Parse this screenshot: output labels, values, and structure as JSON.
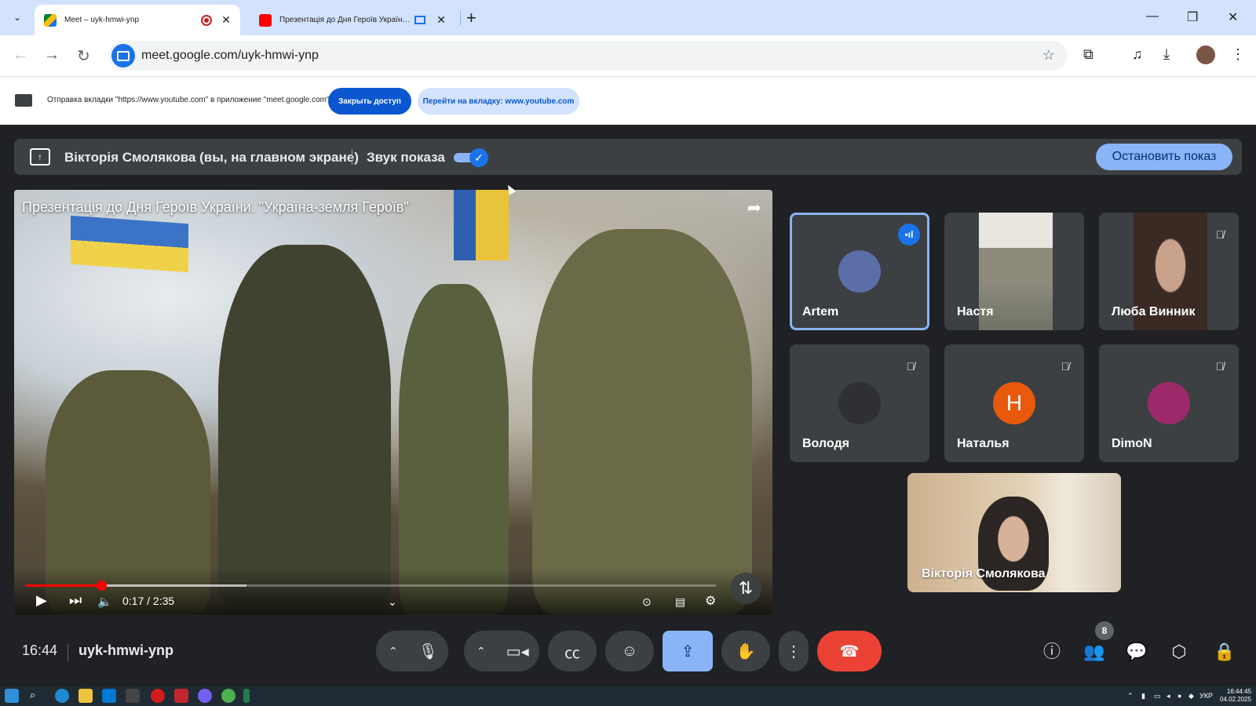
{
  "browser": {
    "tabs": [
      {
        "title": "Meet – uyk-hmwi-ynp",
        "favicon": "google-meet-icon",
        "active": true
      },
      {
        "title": "Презентація до Дня Героїв України. \"Україна-земля Героїв\" - YouTube",
        "favicon": "youtube-icon",
        "active": false
      }
    ],
    "url": "meet.google.com/uyk-hmwi-ynp"
  },
  "banner": {
    "text": "Отправка вкладки \"https://www.youtube.com\" в приложение \"meet.google.com\"...",
    "stop_access_label": "Закрыть доступ",
    "goto_tab_label": "Перейти на вкладку: www.youtube.com"
  },
  "presenting": {
    "label": "Вікторія Смолякова (вы, на главном экране)",
    "sound_label": "Звук показа",
    "sound_on": true,
    "stop_label": "Остановить показ"
  },
  "video": {
    "title": "Презентація до Дня Героїв України. \"Україна-земля Героїв\"",
    "time": "0:17 / 2:35",
    "progress": 0.11,
    "buffered": 0.32
  },
  "participants": [
    {
      "name": "Artem",
      "speaking": true,
      "muted": false,
      "avatar_color": "#5b6ea8",
      "initial": ""
    },
    {
      "name": "Настя",
      "speaking": false,
      "muted": false,
      "avatar_color": "#8d8a7c",
      "initial": ""
    },
    {
      "name": "Люба Винник",
      "speaking": false,
      "muted": true,
      "avatar_color": "#c9a28c",
      "initial": ""
    },
    {
      "name": "Володя",
      "speaking": false,
      "muted": true,
      "avatar_color": "#2e3033",
      "initial": ""
    },
    {
      "name": "Наталья",
      "speaking": false,
      "muted": true,
      "avatar_color": "#e8590c",
      "initial": "Н"
    },
    {
      "name": "DimoN",
      "speaking": false,
      "muted": true,
      "avatar_color": "#9c2a6a",
      "initial": ""
    }
  ],
  "self": {
    "name": "Вікторія Смолякова"
  },
  "meeting": {
    "time": "16:44",
    "code": "uyk-hmwi-ynp",
    "people_count": "8"
  },
  "taskbar": {
    "lang": "УКР",
    "time": "16:44:45",
    "date": "04.02.2025"
  }
}
